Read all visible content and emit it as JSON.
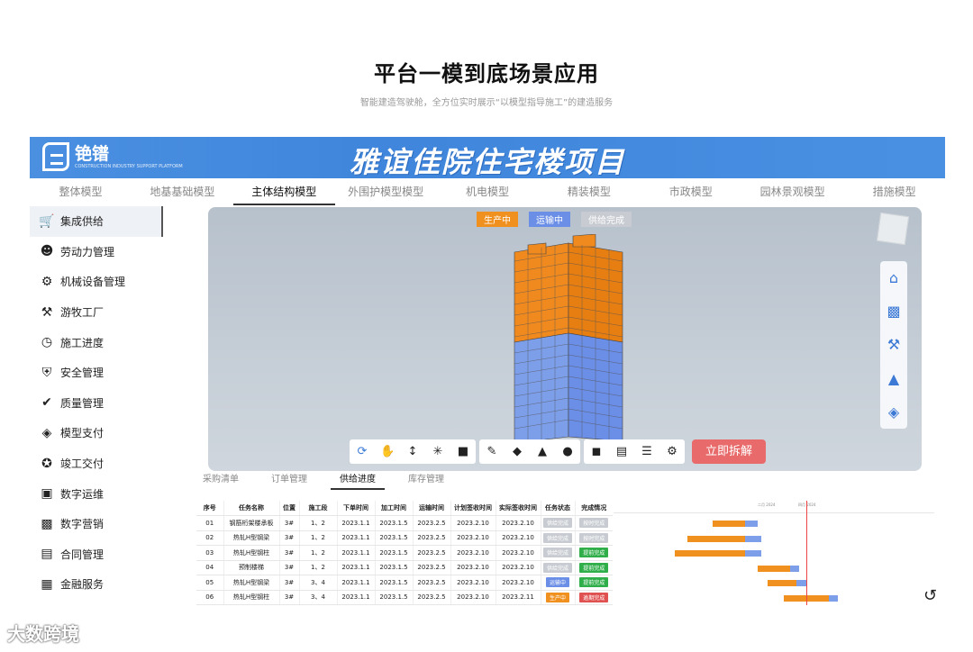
{
  "page": {
    "title": "平台一模到底场景应用",
    "subtitle": "智能建造驾驶舱，全方位实时展示“以模型指导施工”的建造服务"
  },
  "banner": {
    "logo_name": "铯镨",
    "logo_sub": "CONSTRUCTION INDUSTRY SUPPORT PLATFORM",
    "project_title": "雅谊佳院住宅楼项目"
  },
  "model_tabs": [
    {
      "label": "整体模型"
    },
    {
      "label": "地基基础模型"
    },
    {
      "label": "主体结构模型"
    },
    {
      "label": "外围护模型模型"
    },
    {
      "label": "机电模型"
    },
    {
      "label": "精装模型"
    },
    {
      "label": "市政模型"
    },
    {
      "label": "园林景观模型"
    },
    {
      "label": "措施模型"
    }
  ],
  "sidebar": [
    {
      "label": "集成供给",
      "icon": "cart-icon"
    },
    {
      "label": "劳动力管理",
      "icon": "worker-icon"
    },
    {
      "label": "机械设备管理",
      "icon": "excavator-icon"
    },
    {
      "label": "游牧工厂",
      "icon": "robot-arm-icon"
    },
    {
      "label": "施工进度",
      "icon": "clock-icon"
    },
    {
      "label": "安全管理",
      "icon": "shield-icon"
    },
    {
      "label": "质量管理",
      "icon": "quality-shield-icon"
    },
    {
      "label": "模型支付",
      "icon": "payment-icon"
    },
    {
      "label": "竣工交付",
      "icon": "award-icon"
    },
    {
      "label": "数字运维",
      "icon": "monitor-icon"
    },
    {
      "label": "数字营销",
      "icon": "chart-icon"
    },
    {
      "label": "合同管理",
      "icon": "contract-icon"
    },
    {
      "label": "金融服务",
      "icon": "finance-icon"
    }
  ],
  "viewer": {
    "legend": [
      {
        "label": "生产中",
        "color": "#f0901e"
      },
      {
        "label": "运输中",
        "color": "#6b8ee6"
      },
      {
        "label": "供给完成",
        "color": "#c8ccd2"
      }
    ],
    "explode_button": "立即拆解"
  },
  "sub_tabs": [
    {
      "label": "采购清单"
    },
    {
      "label": "订单管理"
    },
    {
      "label": "供给进度"
    },
    {
      "label": "库存管理"
    }
  ],
  "table": {
    "headers": [
      "序号",
      "任务名称",
      "位置",
      "施工段",
      "下单时间",
      "加工时间",
      "运输时间",
      "计划签收时间",
      "实际签收时间",
      "任务状态",
      "完成情况"
    ],
    "rows": [
      [
        "01",
        "钢筋桁架楼承板",
        "3#",
        "1、2",
        "2023.1.1",
        "2023.1.5",
        "2023.2.5",
        "2023.2.10",
        "2023.2.10",
        "供给完成",
        "按时完成"
      ],
      [
        "02",
        "热轧H型钢梁",
        "3#",
        "1、2",
        "2023.1.1",
        "2023.1.5",
        "2023.2.5",
        "2023.2.10",
        "2023.2.10",
        "供给完成",
        "按时完成"
      ],
      [
        "03",
        "热轧H型钢柱",
        "3#",
        "1、2",
        "2023.1.1",
        "2023.1.5",
        "2023.2.5",
        "2023.2.10",
        "2023.2.10",
        "供给完成",
        "提前完成"
      ],
      [
        "04",
        "预制楼梯",
        "3#",
        "1、2",
        "2023.1.1",
        "2023.1.5",
        "2023.2.5",
        "2023.2.10",
        "2023.2.10",
        "供给完成",
        "提前完成"
      ],
      [
        "05",
        "热轧H型钢梁",
        "3#",
        "3、4",
        "2023.1.1",
        "2023.1.5",
        "2023.2.5",
        "2023.2.10",
        "2023.2.10",
        "运输中",
        "提前完成"
      ],
      [
        "06",
        "热轧H型钢柱",
        "3#",
        "3、4",
        "2023.1.1",
        "2023.1.5",
        "2023.2.5",
        "2023.2.10",
        "2023.2.11",
        "生产中",
        "逾期完成"
      ]
    ],
    "status_colors": {
      "供给完成": "#c8ccd2",
      "运输中": "#6b8ee6",
      "生产中": "#f0901e"
    },
    "completion_colors": {
      "按时完成": "#c8ccd2",
      "提前完成": "#2fae4a",
      "逾期完成": "#e05252"
    }
  },
  "gantt": {
    "header_labels": [
      "二月 2024",
      "四月 2024"
    ],
    "bars": [
      {
        "orange": [
          0.31,
          0.41
        ],
        "blue": [
          0.41,
          0.45
        ]
      },
      {
        "orange": [
          0.23,
          0.41
        ],
        "blue": [
          0.41,
          0.46
        ]
      },
      {
        "orange": [
          0.19,
          0.41
        ],
        "blue": [
          0.41,
          0.46
        ]
      },
      {
        "orange": [
          0.45,
          0.55
        ],
        "blue": [
          0.55,
          0.58
        ]
      },
      {
        "orange": [
          0.48,
          0.57
        ],
        "blue": [
          0.57,
          0.6
        ]
      },
      {
        "orange": [
          0.53,
          0.67
        ],
        "blue": [
          0.67,
          0.7
        ]
      }
    ],
    "today": 0.6
  },
  "watermark": "大数跨境"
}
